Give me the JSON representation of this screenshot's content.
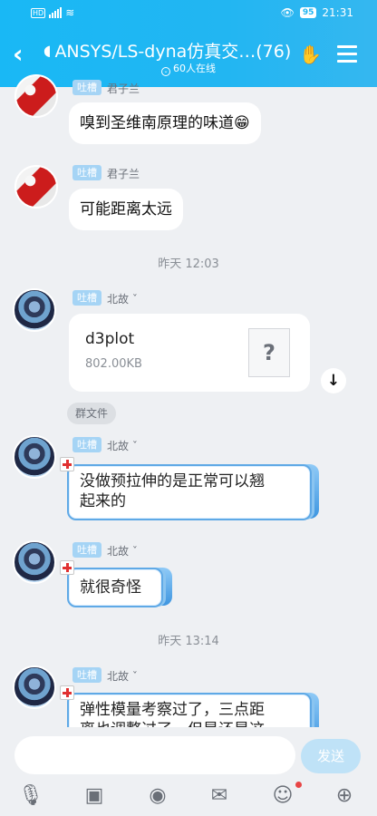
{
  "status_bar": {
    "network": "HD",
    "signal_label": "4G",
    "eye": "👁",
    "battery": "95",
    "time": "21:31"
  },
  "header": {
    "back": "‹",
    "title": "ANSYS/LS-dyna仿真交…(76)",
    "online": "60人在线",
    "ear_icon": "ear-icon",
    "hand_icon": "hand-icon",
    "menu_icon": "menu-icon"
  },
  "messages": [
    {
      "tag": "吐槽",
      "sender": "君子兰",
      "text": "嗅到圣维南原理的味道😁"
    },
    {
      "tag": "吐槽",
      "sender": "君子兰",
      "text": "可能距离太远"
    },
    {
      "time": "昨天 12:03"
    },
    {
      "tag": "吐槽",
      "sender": "北故 ˇ",
      "file_name": "d3plot",
      "file_size": "802.00KB",
      "file_icon": "?"
    },
    {
      "badge": "群文件"
    },
    {
      "tag": "吐槽",
      "sender": "北故 ˇ",
      "text_line1": "没做预拉伸的是正常可以翘",
      "text_line2": "起来的"
    },
    {
      "tag": "吐槽",
      "sender": "北故 ˇ",
      "text": "就很奇怪"
    },
    {
      "time": "昨天 13:14"
    },
    {
      "tag": "吐槽",
      "sender": "北故 ˇ",
      "text_line1": "弹性模量考察过了，三点距",
      "text_line2": "离也调整过了，但是还是这"
    }
  ],
  "composer": {
    "send": "发送"
  },
  "toolbar_icons": [
    "microphone-icon",
    "image-icon",
    "camera-icon",
    "red-packet-icon",
    "emoji-icon",
    "plus-icon"
  ]
}
